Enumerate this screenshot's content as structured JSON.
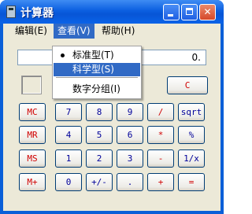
{
  "window": {
    "title": "计算器"
  },
  "menu": {
    "edit": "编辑(E)",
    "view": "查看(V)",
    "help": "帮助(H)"
  },
  "view_menu": {
    "standard": "标准型(T)",
    "scientific": "科学型(S)",
    "digit_grouping": "数字分组(I)"
  },
  "display": {
    "value": "0."
  },
  "buttons": {
    "c": "C",
    "mc": "MC",
    "mr": "MR",
    "ms": "MS",
    "mplus": "M+",
    "n7": "7",
    "n8": "8",
    "n9": "9",
    "div": "/",
    "sqrt": "sqrt",
    "n4": "4",
    "n5": "5",
    "n6": "6",
    "mul": "*",
    "pct": "%",
    "n1": "1",
    "n2": "2",
    "n3": "3",
    "sub": "-",
    "inv": "1/x",
    "n0": "0",
    "sign": "+/-",
    "dot": ".",
    "add": "+",
    "eq": "="
  }
}
